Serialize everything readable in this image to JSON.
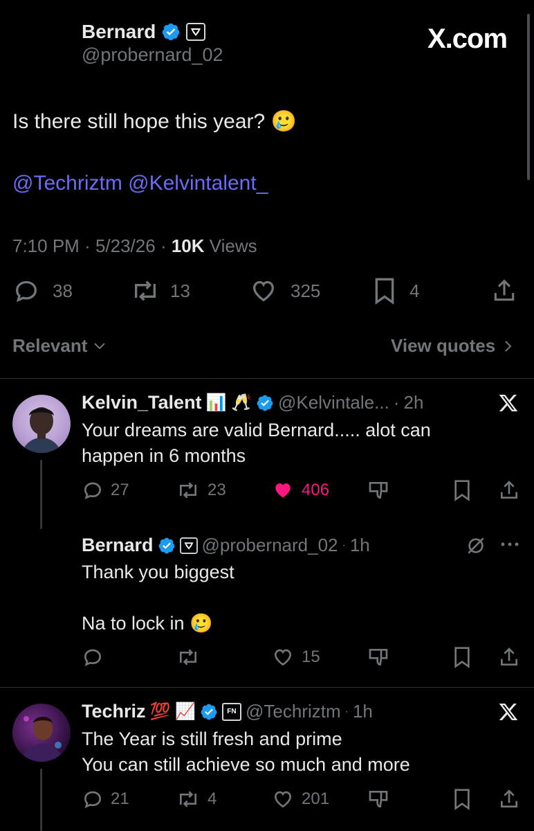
{
  "watermark": "X.com",
  "main_post": {
    "author_name": "Bernard",
    "handle": "@probernard_02",
    "text": "Is there still hope this year? 🥲",
    "mentions": "@Techriztm @Kelvintalent_",
    "time": "7:10 PM",
    "date": "5/23/26",
    "views_count": "10K",
    "views_label": "Views",
    "replies": "38",
    "reposts": "13",
    "likes": "325",
    "bookmarks": "4"
  },
  "sort": {
    "label": "Relevant",
    "view_quotes": "View quotes"
  },
  "replies": [
    {
      "author_name": "Kelvin_Talent",
      "name_emoji": "📊 🥂",
      "handle": "@Kelvintale...",
      "time": "2h",
      "text_line1": "Your dreams are valid Bernard..... alot can",
      "text_line2": "happen in 6 months",
      "replies": "27",
      "reposts": "23",
      "likes": "406",
      "liked": true
    },
    {
      "author_name": "Bernard",
      "handle": "@probernard_02",
      "time": "1h",
      "text_line1": "Thank you biggest",
      "text_line2": "Na to lock in 🥲",
      "replies": "",
      "reposts": "",
      "likes": "15"
    },
    {
      "author_name": "Techriz",
      "name_emoji": "💯 📈",
      "badge_text": "FN",
      "handle": "@Techriztm",
      "time": "1h",
      "text_line1": "The Year is still fresh and prime",
      "text_line2": "You can still achieve so much and more",
      "replies": "21",
      "reposts": "4",
      "likes": "201"
    }
  ],
  "colors": {
    "background": "#000000",
    "text": "#e7e9ea",
    "muted": "#71767b",
    "link": "#6b6bf5",
    "verified": "#1d9bf0",
    "like_active": "#f91880"
  }
}
